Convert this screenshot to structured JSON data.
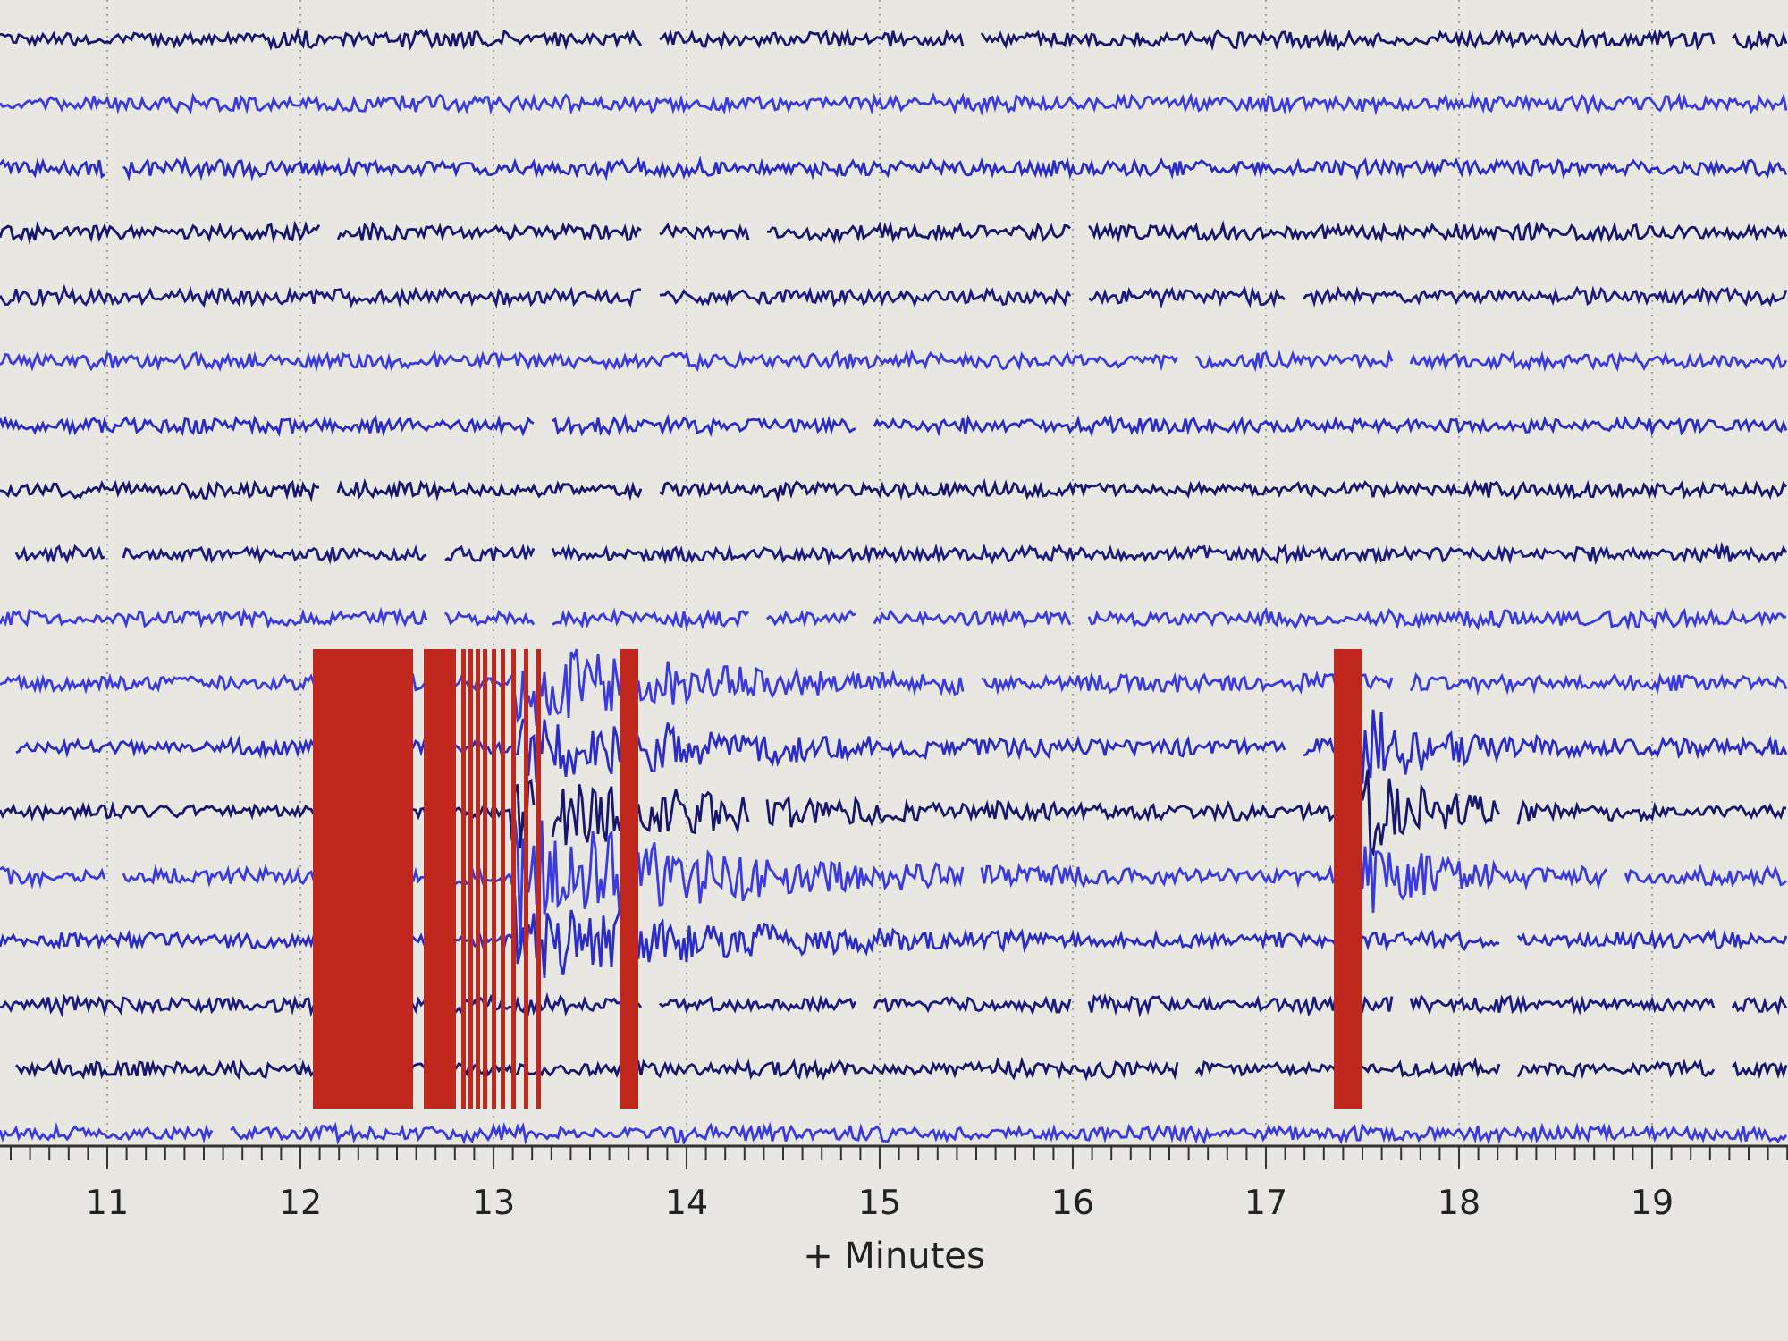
{
  "seismogram": {
    "x_tick_labels": [
      "11",
      "12",
      "13",
      "14",
      "15",
      "16",
      "17",
      "18",
      "19"
    ],
    "x_axis_title": "+ Minutes"
  }
}
